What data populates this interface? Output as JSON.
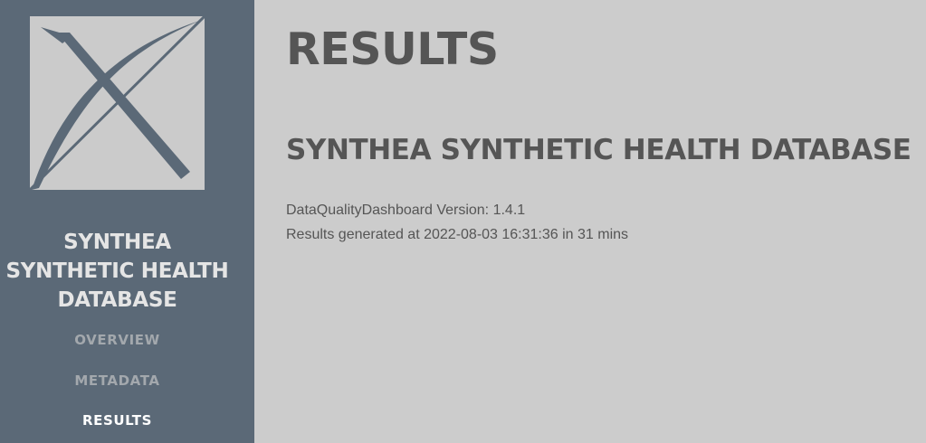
{
  "sidebar": {
    "db_name_lines": [
      "SYNTHEA",
      "SYNTHETIC HEALTH",
      "DATABASE"
    ],
    "nav": [
      {
        "label": "OVERVIEW"
      },
      {
        "label": "METADATA"
      },
      {
        "label": "RESULTS"
      }
    ],
    "logo_icon": "ohdsi-logo-icon"
  },
  "main": {
    "title": "RESULTS",
    "db_title": "SYNTHEA SYNTHETIC HEALTH DATABASE",
    "version_text": "DataQualityDashboard Version: 1.4.1",
    "generated_text": "Results generated at 2022-08-03 16:31:36 in 31 mins"
  },
  "colors": {
    "sidebar_bg": "#5b6977",
    "main_bg": "#cccccc",
    "text": "#555555",
    "nav_inactive": "#a3a8ad",
    "nav_active": "#ffffff"
  }
}
